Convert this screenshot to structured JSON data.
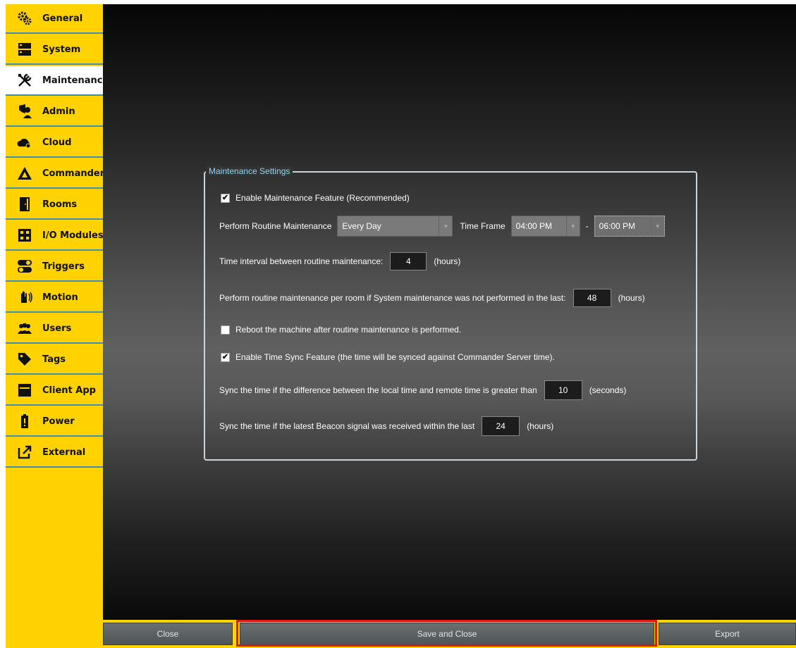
{
  "sidebar": {
    "items": [
      {
        "label": "General",
        "icon": "gears-icon"
      },
      {
        "label": "System",
        "icon": "server-icon"
      },
      {
        "label": "Maintenance",
        "icon": "tools-icon",
        "active": true
      },
      {
        "label": "Admin",
        "icon": "admin-shield-icon"
      },
      {
        "label": "Cloud",
        "icon": "cloud-icon"
      },
      {
        "label": "Commander",
        "icon": "commander-logo-icon"
      },
      {
        "label": "Rooms",
        "icon": "door-icon"
      },
      {
        "label": "I/O Modules",
        "icon": "io-module-icon"
      },
      {
        "label": "Triggers",
        "icon": "toggle-icon"
      },
      {
        "label": "Motion",
        "icon": "motion-hand-icon"
      },
      {
        "label": "Users",
        "icon": "users-icon"
      },
      {
        "label": "Tags",
        "icon": "tag-icon"
      },
      {
        "label": "Client App",
        "icon": "app-window-icon"
      },
      {
        "label": "Power",
        "icon": "battery-icon"
      },
      {
        "label": "External",
        "icon": "external-link-icon"
      }
    ]
  },
  "maintenance": {
    "group_title": "Maintenance Settings",
    "enable_feature": {
      "label": "Enable Maintenance Feature (Recommended)",
      "checked": true
    },
    "routine": {
      "label": "Perform Routine Maintenance",
      "frequency": "Every Day",
      "time_frame_label": "Time Frame",
      "start_time": "04:00 PM",
      "separator": "-",
      "end_time": "06:00 PM"
    },
    "interval": {
      "label": "Time interval between routine maintenance:",
      "value": "4",
      "unit": "(hours)"
    },
    "per_room": {
      "label": "Perform routine maintenance per room if System maintenance was not performed in the last:",
      "value": "48",
      "unit": "(hours)"
    },
    "reboot": {
      "label": "Reboot the machine after routine maintenance is performed.",
      "checked": false
    },
    "time_sync": {
      "label": "Enable Time Sync Feature (the time will be synced against Commander Server time).",
      "checked": true
    },
    "sync_difference": {
      "label": "Sync the time if the difference between the local time and remote time is greater than",
      "value": "10",
      "unit": "(seconds)"
    },
    "sync_beacon": {
      "label": "Sync the time if the latest Beacon signal was received within the last",
      "value": "24",
      "unit": "(hours)"
    }
  },
  "footer": {
    "close_label": "Close",
    "save_close_label": "Save and Close",
    "export_label": "Export"
  },
  "colors": {
    "sidebar_bg": "#ffd200",
    "accent_border": "#3d8fb5",
    "highlight": "#e0160f"
  }
}
